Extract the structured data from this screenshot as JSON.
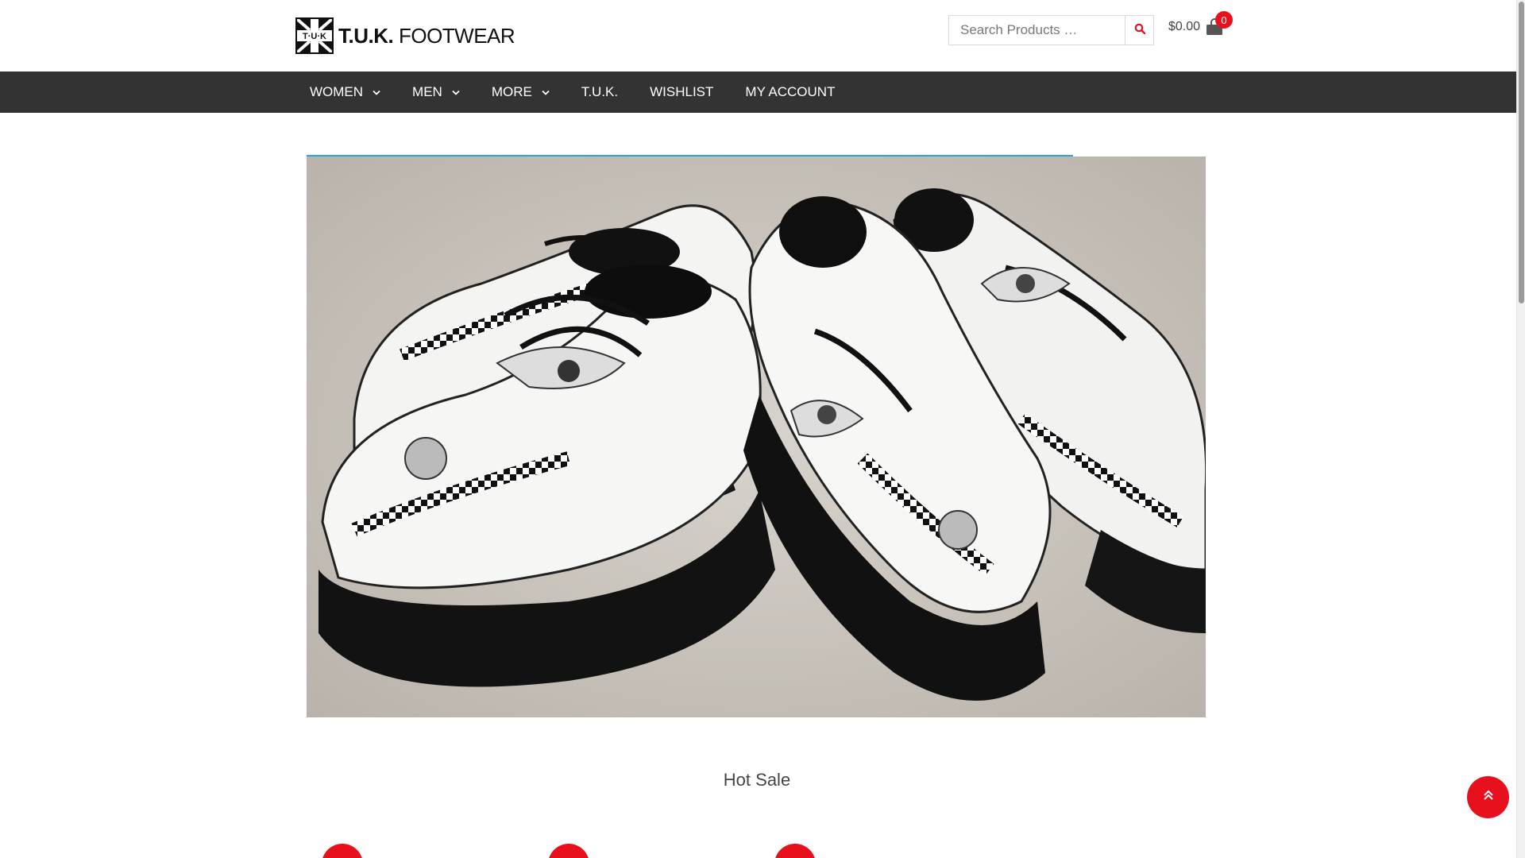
{
  "brand": {
    "mark_text": "T·U·K",
    "name_bold": "T.U.K.",
    "name_rest": " FOOTWEAR"
  },
  "search": {
    "placeholder": "Search Products …",
    "icon": "search-icon"
  },
  "cart": {
    "total": "$0.00",
    "count": "0",
    "icon": "shopping-bag-icon"
  },
  "nav": {
    "items": [
      {
        "label": "WOMEN",
        "has_dropdown": true
      },
      {
        "label": "MEN",
        "has_dropdown": true
      },
      {
        "label": "MORE",
        "has_dropdown": true
      },
      {
        "label": "T.U.K.",
        "has_dropdown": false
      },
      {
        "label": "WISHLIST",
        "has_dropdown": false
      },
      {
        "label": "MY ACCOUNT",
        "has_dropdown": false
      }
    ]
  },
  "hero": {
    "image": "white creeper shoes with black checkered trim and illustrated eyes and roses on concrete"
  },
  "sections": {
    "hot_sale_title": "Hot Sale"
  },
  "back_to_top": {
    "icon": "double-chevron-up-icon"
  },
  "colors": {
    "nav_bg": "#333333",
    "accent_red": "#e8101c",
    "accent_blue": "#2aa3e0"
  }
}
